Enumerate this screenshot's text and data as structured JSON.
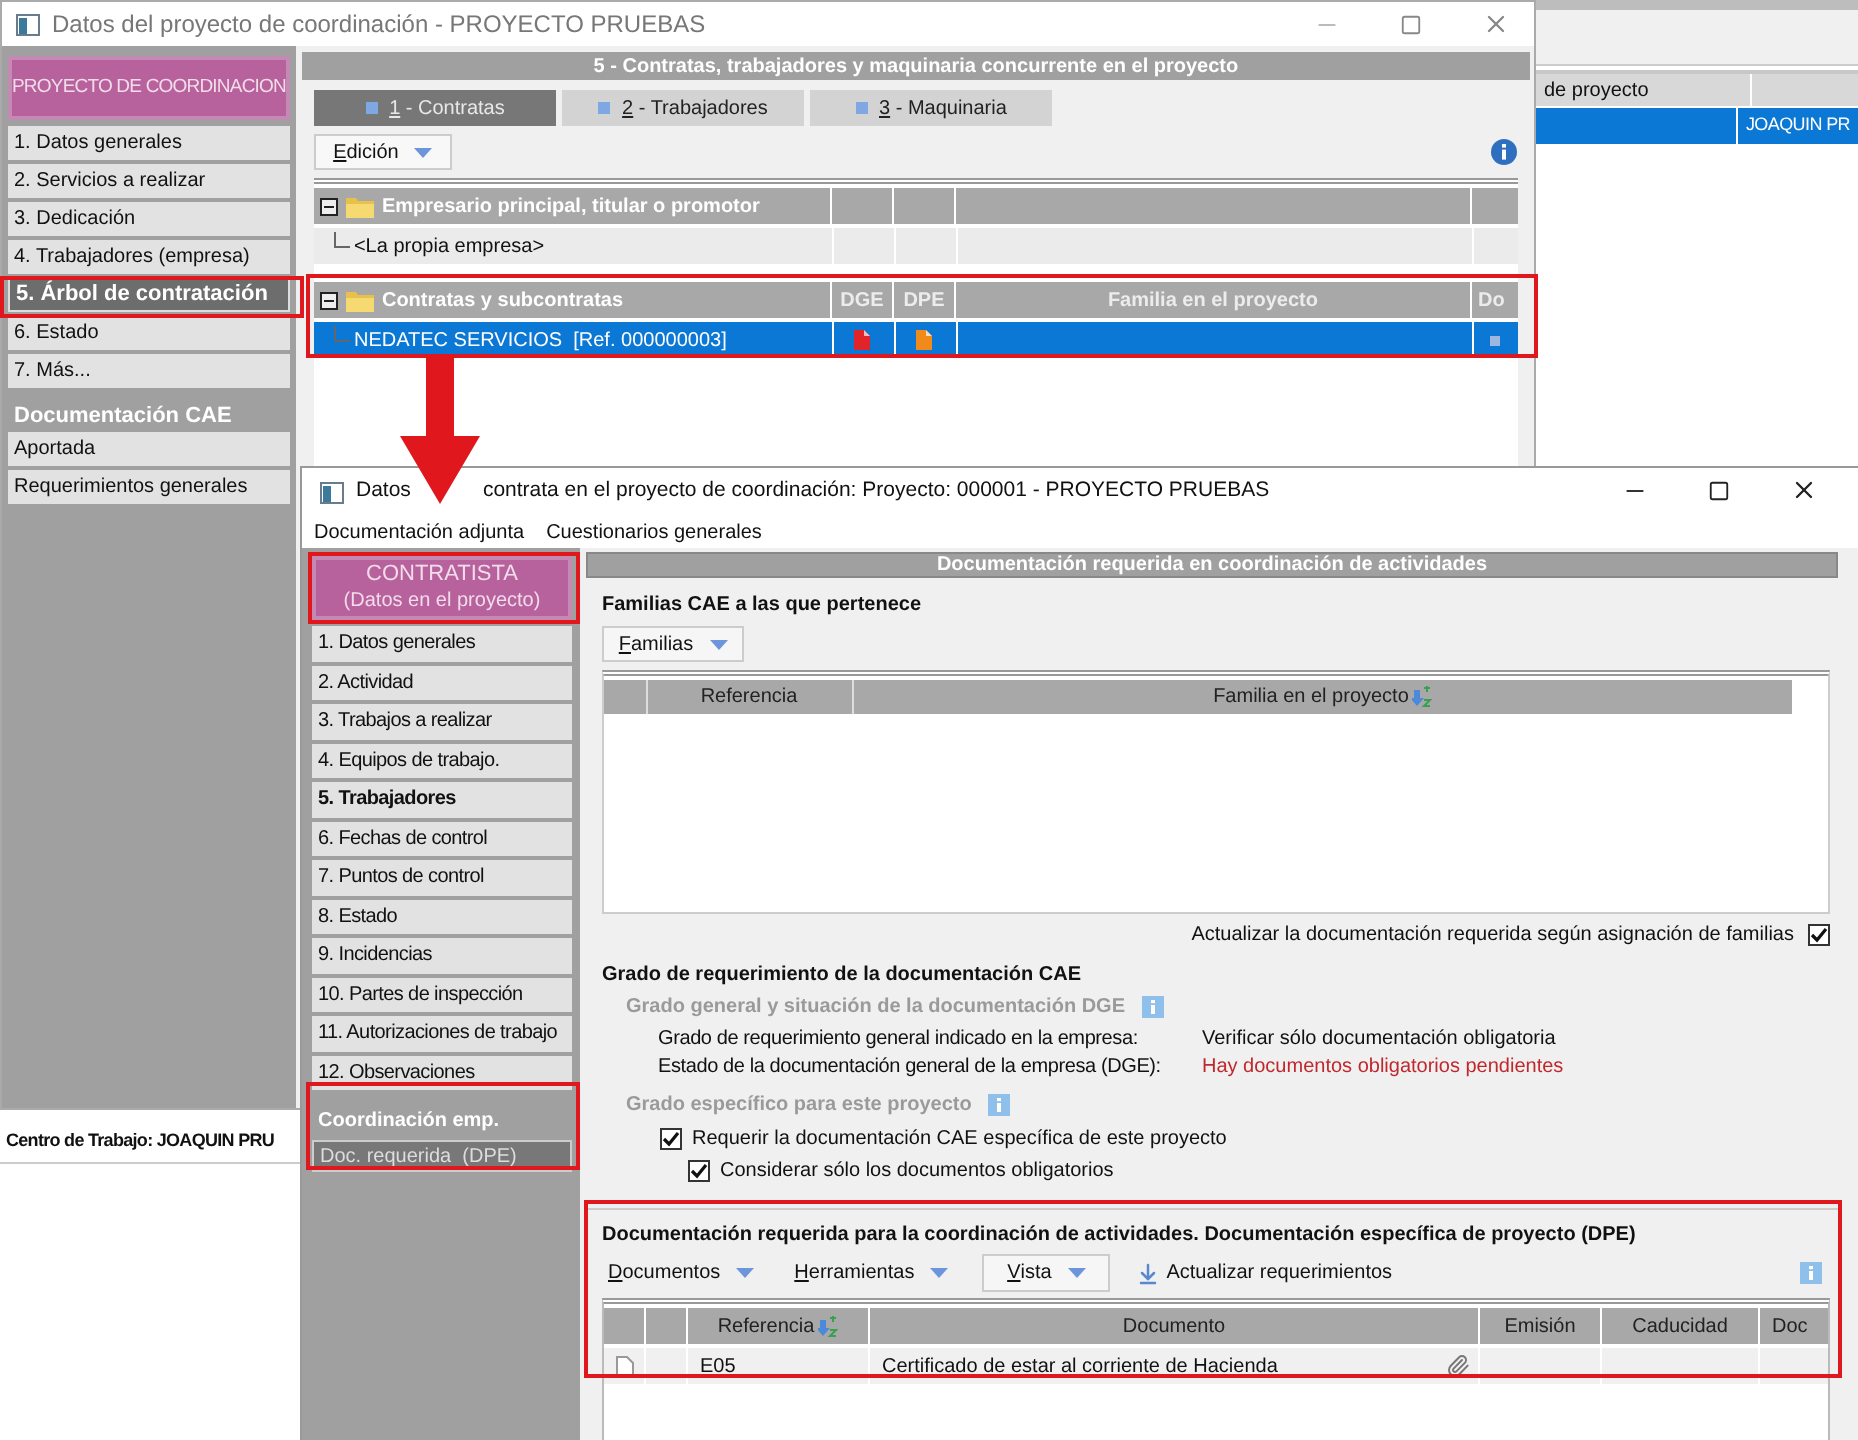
{
  "background_window": {
    "grid_column": "de proyecto",
    "grid_row": {
      "cell": "JOAQUIN PR",
      "selected": true
    },
    "status": "Centro de Trabajo: JOAQUIN PRU"
  },
  "project_window": {
    "title": "Datos del proyecto de coordinación -  PROYECTO PRUEBAS",
    "header": "PROYECTO DE COORDINACION",
    "nav_items": [
      {
        "label": "1. Datos generales",
        "selected": false
      },
      {
        "label": "2. Servicios a realizar",
        "selected": false
      },
      {
        "label": "3. Dedicación",
        "selected": false
      },
      {
        "label": "4. Trabajadores (empresa)",
        "selected": false
      },
      {
        "label": "5. Árbol de contratación",
        "selected": true
      },
      {
        "label": "6. Estado",
        "selected": false
      },
      {
        "label": "7. Más...",
        "selected": false
      }
    ],
    "section": "Documentación CAE",
    "section_items": [
      {
        "label": "Aportada",
        "selected": false
      },
      {
        "label": "Requerimientos generales",
        "selected": false
      }
    ],
    "panel_title": "5 - Contratas, trabajadores y maquinaria concurrente en el proyecto",
    "tabs": [
      {
        "label": "1 - Contratas",
        "selected": true
      },
      {
        "label": "2 - Trabajadores",
        "selected": false
      },
      {
        "label": "3 - Maquinaria",
        "selected": false
      }
    ],
    "menu": "Edición",
    "tree": [
      {
        "label": "Empresario principal, titular o promotor",
        "expanded": true,
        "children": [
          {
            "label": "<La propia empresa>",
            "selected": false,
            "has_documents": false
          }
        ]
      },
      {
        "label": "Contratas y subcontratas",
        "expanded": true,
        "columns": [
          "DGE",
          "DPE",
          "Familia en el proyecto",
          "Do"
        ],
        "children": [
          {
            "label": "NEDATEC SERVICIOS  [Ref. 000000003]",
            "selected": true,
            "has_documents": true
          }
        ]
      }
    ]
  },
  "contract_window": {
    "title_start": "Datos",
    "title_rest": "contrata en el proyecto de coordinación: Proyecto: 000001 - PROYECTO PRUEBAS",
    "menu": [
      "Documentación adjunta",
      "Cuestionarios generales"
    ],
    "header": {
      "title": "CONTRATISTA",
      "subtitle": "(Datos en el proyecto)"
    },
    "nav_items": [
      {
        "label": "1. Datos generales",
        "emphasized": false
      },
      {
        "label": "2. Actividad",
        "emphasized": false
      },
      {
        "label": "3. Trabajos a realizar",
        "emphasized": false
      },
      {
        "label": "4. Equipos de trabajo.",
        "emphasized": false
      },
      {
        "label": "5. Trabajadores",
        "emphasized": true
      },
      {
        "label": "6. Fechas de control",
        "emphasized": false
      },
      {
        "label": "7. Puntos de control",
        "emphasized": false
      },
      {
        "label": "8. Estado",
        "emphasized": false
      },
      {
        "label": "9. Incidencias",
        "emphasized": false
      },
      {
        "label": "10. Partes de inspección",
        "emphasized": false
      },
      {
        "label": "11. Autorizaciones de trabajo",
        "emphasized": false
      },
      {
        "label": "12. Observaciones",
        "emphasized": false
      }
    ],
    "section": "Coordinación emp.",
    "section_items": [
      {
        "label": "Doc. requerida  (DPE)",
        "selected": true
      }
    ],
    "panel_title": "Documentación requerida en coordinación de actividades",
    "families": {
      "heading": "Familias CAE a las que pertenece",
      "menu": "Familias",
      "columns": [
        {
          "label": "Referencia",
          "sorted": false
        },
        {
          "label": "Familia en el proyecto",
          "sorted": true
        }
      ],
      "update_option": {
        "label": "Actualizar la documentación requerida según asignación de familias",
        "checked": true
      }
    },
    "requirements": {
      "heading": "Grado de requerimiento de la documentación CAE",
      "general": {
        "heading": "Grado general y situación de la documentación DGE",
        "rows": [
          {
            "label": "Grado de requerimiento general indicado en la empresa:",
            "value": "Verificar sólo documentación obligatoria",
            "alert": false
          },
          {
            "label": "Estado de la documentación general de la empresa (DGE):",
            "value": "Hay documentos obligatorios pendientes",
            "alert": true
          }
        ]
      },
      "specific": {
        "heading": "Grado específico para este proyecto",
        "options": [
          {
            "label": "Requerir la documentación CAE específica de este proyecto",
            "checked": true,
            "children": [
              {
                "label": "Considerar sólo los documentos obligatorios",
                "checked": true
              }
            ]
          }
        ]
      }
    },
    "documents": {
      "heading": "Documentación requerida para la coordinación de actividades. Documentación específica de proyecto (DPE)",
      "toolbar": [
        {
          "label": "Documentos",
          "kind": "menu"
        },
        {
          "label": "Herramientas",
          "kind": "menu"
        },
        {
          "label": "Vista",
          "kind": "menu-button"
        },
        {
          "label": "Actualizar requerimientos",
          "kind": "action"
        }
      ],
      "columns": [
        {
          "label": "Referencia",
          "sorted": true
        },
        {
          "label": "Documento",
          "sorted": false
        },
        {
          "label": "Emisión",
          "sorted": false
        },
        {
          "label": "Caducidad",
          "sorted": false
        },
        {
          "label": "Doc",
          "sorted": false
        }
      ],
      "rows": [
        {
          "reference": "E05",
          "document": "Certificado de estar al corriente de Hacienda",
          "attachment": true
        }
      ]
    }
  }
}
